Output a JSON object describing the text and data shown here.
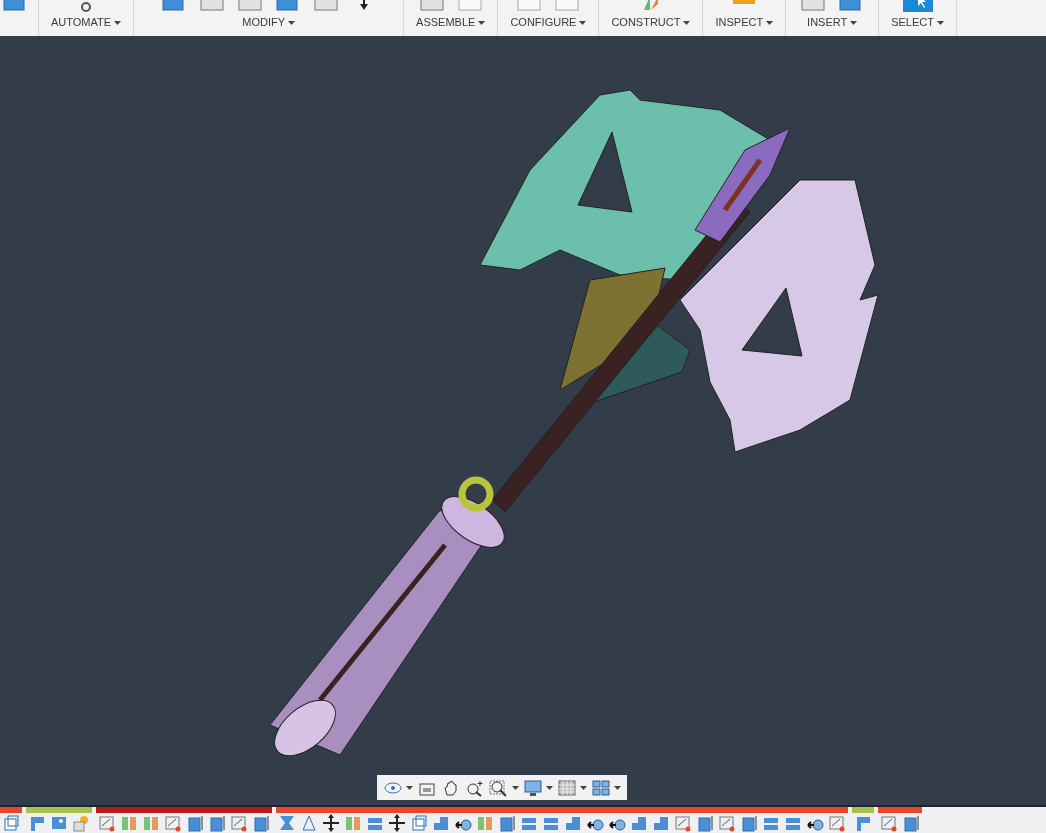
{
  "toolbar": {
    "groups": [
      {
        "label": "AUTOMATE"
      },
      {
        "label": "MODIFY"
      },
      {
        "label": "ASSEMBLE"
      },
      {
        "label": "CONFIGURE"
      },
      {
        "label": "CONSTRUCT"
      },
      {
        "label": "INSPECT"
      },
      {
        "label": "INSERT"
      },
      {
        "label": "SELECT"
      }
    ]
  },
  "navigation_bar": {
    "tools": [
      {
        "kind": "orbit",
        "dropdown": true
      },
      {
        "kind": "look-at",
        "dropdown": false
      },
      {
        "kind": "pan",
        "dropdown": false
      },
      {
        "kind": "zoom",
        "dropdown": false
      },
      {
        "kind": "zoom-window",
        "dropdown": true
      },
      {
        "kind": "display",
        "dropdown": true
      },
      {
        "kind": "grid",
        "dropdown": true
      },
      {
        "kind": "viewports",
        "dropdown": true
      }
    ]
  },
  "timeline": {
    "groups": [
      {
        "color": "#e8452a"
      },
      {
        "color": "#a9c04b"
      },
      {
        "color": "#b71c1c"
      },
      {
        "color": "#e8452a"
      },
      {
        "color": "#a9c04b"
      },
      {
        "color": "#e8452a"
      }
    ]
  }
}
